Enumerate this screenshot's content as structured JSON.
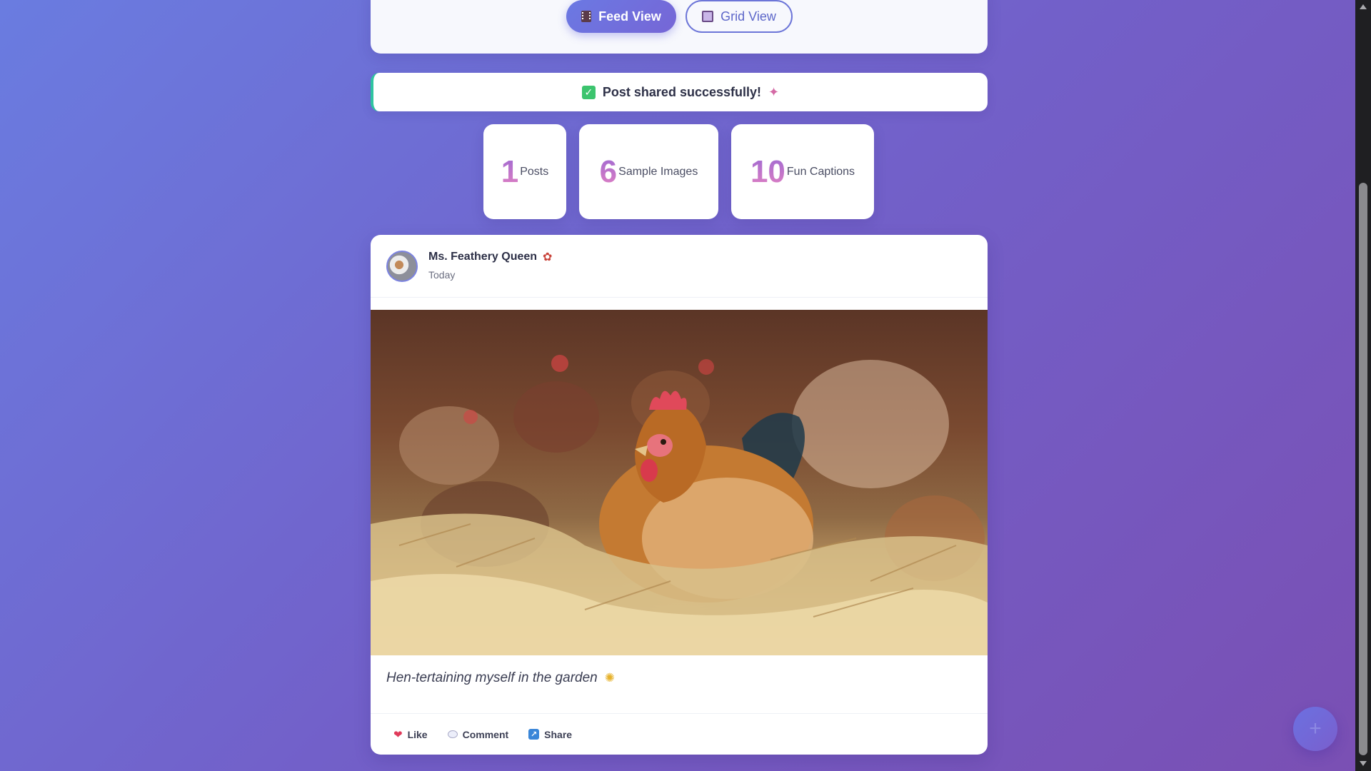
{
  "view_toggle": {
    "feed_label": "Feed View",
    "grid_label": "Grid View",
    "active": "feed"
  },
  "banner": {
    "message": "Post shared successfully!"
  },
  "stats": [
    {
      "value": "1",
      "label": "Posts"
    },
    {
      "value": "6",
      "label": "Sample Images"
    },
    {
      "value": "10",
      "label": "Fun Captions"
    }
  ],
  "post": {
    "author": "Ms. Feathery Queen",
    "time": "Today",
    "caption": "Hen-tertaining myself in the garden",
    "actions": {
      "like": "Like",
      "comment": "Comment",
      "share": "Share"
    }
  },
  "fab": {
    "icon": "plus-icon"
  },
  "colors": {
    "accent": "#6b79e3",
    "success": "#2fc4a0",
    "stat_gradient_start": "#a06ad2",
    "stat_gradient_end": "#e07fc2"
  }
}
